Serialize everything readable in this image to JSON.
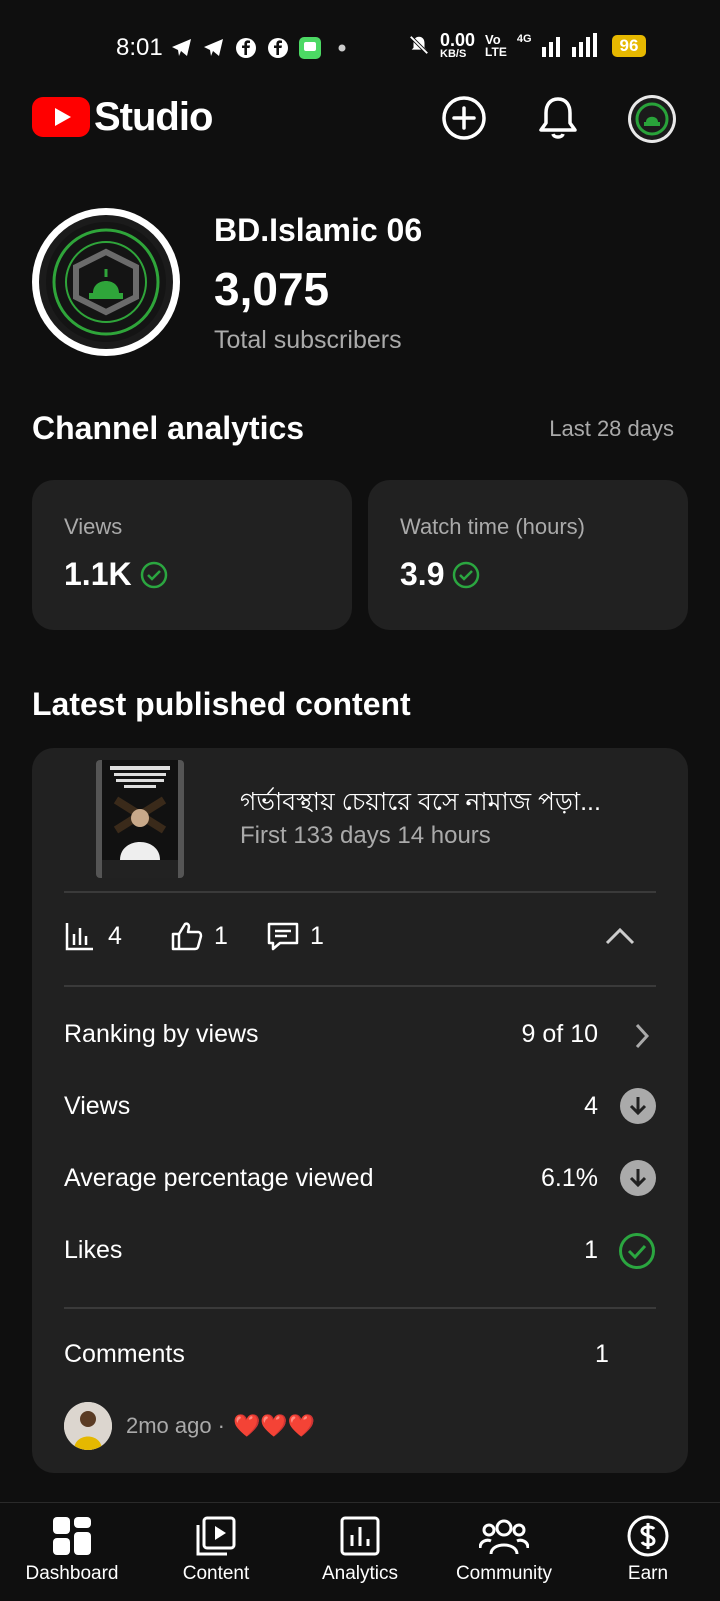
{
  "status_bar": {
    "time": "8:01",
    "net_speed": "0.00",
    "net_unit": "KB/S",
    "vo_lte_top": "Vo",
    "vo_lte_bottom": "LTE",
    "network": "4G",
    "battery": "96"
  },
  "header": {
    "app_name": "Studio",
    "icons": [
      "create-icon",
      "bell-icon",
      "account-avatar"
    ]
  },
  "channel": {
    "name": "BD.Islamic 06",
    "subscribers": "3,075",
    "subscribers_label": "Total subscribers"
  },
  "analytics": {
    "title": "Channel analytics",
    "period": "Last 28 days",
    "cards": [
      {
        "label": "Views",
        "value": "1.1K"
      },
      {
        "label": "Watch time (hours)",
        "value": "3.9"
      }
    ]
  },
  "latest": {
    "title": "Latest published content",
    "video_title": "গর্ভাবস্থায় চেয়ারে বসে নামাজ পড়া...",
    "video_meta": "First 133 days 14 hours",
    "stats": {
      "views": "4",
      "likes": "1",
      "comments": "1"
    },
    "rows": [
      {
        "label": "Ranking by views",
        "value": "9 of 10"
      },
      {
        "label": "Views",
        "value": "4"
      },
      {
        "label": "Average percentage viewed",
        "value": "6.1%"
      },
      {
        "label": "Likes",
        "value": "1"
      }
    ],
    "comments_label": "Comments",
    "comments_count": "1",
    "comment_time": "2mo ago",
    "comment_separator": "·",
    "comment_text": "❤️❤️❤️"
  },
  "nav": [
    {
      "label": "Dashboard"
    },
    {
      "label": "Content"
    },
    {
      "label": "Analytics"
    },
    {
      "label": "Community"
    },
    {
      "label": "Earn"
    }
  ],
  "colors": {
    "background": "#0f0f0f",
    "card": "#212121",
    "brand_red": "#ff0000",
    "success_green": "#2ba640",
    "battery": "#e6b800"
  }
}
